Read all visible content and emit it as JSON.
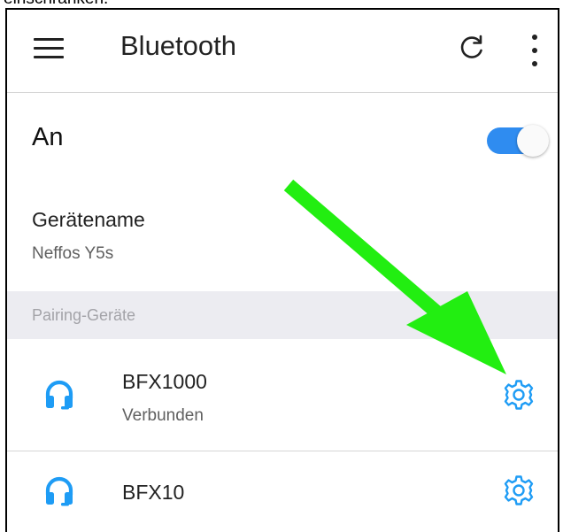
{
  "caption_fragment": "einschränken.",
  "appbar": {
    "title": "Bluetooth",
    "menu_icon": "hamburger-menu-icon",
    "refresh_icon": "refresh-icon",
    "more_icon": "more-vertical-icon"
  },
  "bluetooth_toggle": {
    "label": "An",
    "state": "on",
    "color": "#2f8cf0"
  },
  "device_name": {
    "label": "Gerätename",
    "value": "Neffos Y5s"
  },
  "paired_section": {
    "header": "Pairing-Geräte",
    "devices": [
      {
        "name": "BFX1000",
        "status": "Verbunden",
        "icon": "headphones-icon",
        "settings_icon": "gear-icon"
      },
      {
        "name": "BFX10",
        "status": "",
        "icon": "headphones-icon",
        "settings_icon": "gear-icon"
      }
    ]
  },
  "colors": {
    "accent_blue": "#2f8cf0",
    "annotation_arrow": "#22ee11",
    "section_bg": "#ececf1"
  },
  "annotation": {
    "type": "arrow",
    "points_to": "settings button of BFX1000"
  }
}
